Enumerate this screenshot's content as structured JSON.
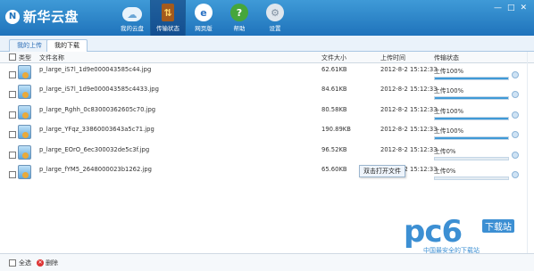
{
  "app": {
    "logo_letter": "N",
    "title": "新华云盘",
    "window_controls": [
      "—",
      "□",
      "✕"
    ]
  },
  "nav": [
    {
      "label": "我的云盘",
      "icon": "cloud-icon"
    },
    {
      "label": "传输状态",
      "icon": "transfer-icon",
      "active": true
    },
    {
      "label": "网页版",
      "icon": "ie-icon"
    },
    {
      "label": "帮助",
      "icon": "help-icon"
    },
    {
      "label": "设置",
      "icon": "gear-icon"
    }
  ],
  "tabs": {
    "upload": "我的上传",
    "download": "我的下载"
  },
  "columns": {
    "type": "类型",
    "name": "文件名称",
    "size": "文件大小",
    "time": "上传时间",
    "status": "传输状态"
  },
  "rows": [
    {
      "name": "p_large_iS7l_1d9e000043585c44.jpg",
      "size": "62.61KB",
      "time": "2012-8-2 15:12:33",
      "status": "上传100%",
      "progress": 1.0
    },
    {
      "name": "p_large_iS7l_1d9e000043585c4433.jpg",
      "size": "84.61KB",
      "time": "2012-8-2 15:12:33",
      "status": "上传100%",
      "progress": 1.0
    },
    {
      "name": "p_large_Rghh_0c83000362605c70.jpg",
      "size": "80.58KB",
      "time": "2012-8-2 15:12:33",
      "status": "上传100%",
      "progress": 1.0
    },
    {
      "name": "p_large_YFqz_33860003643a5c71.jpg",
      "size": "190.89KB",
      "time": "2012-8-2 15:12:33",
      "status": "上传100%",
      "progress": 1.0
    },
    {
      "name": "p_large_EOrO_6ec300032de5c3f.jpg",
      "size": "96.52KB",
      "time": "2012-8-2 15:12:33",
      "status": "上传0%",
      "progress": 0.0
    },
    {
      "name": "p_large_fYM5_2648000023b1262.jpg",
      "size": "65.60KB",
      "time": "2012-8-2 15:12:33",
      "status": "上传0%",
      "progress": 0.0
    }
  ],
  "tooltip": "双击打开文件",
  "footer": {
    "select_all": "全选",
    "delete": "删除"
  },
  "watermark": {
    "brand": "pc6",
    "tag": "下载站",
    "subtitle": "中国最安全的下载站"
  },
  "colors": {
    "header": "#1f73bb",
    "progress": "#3f9ad7"
  }
}
